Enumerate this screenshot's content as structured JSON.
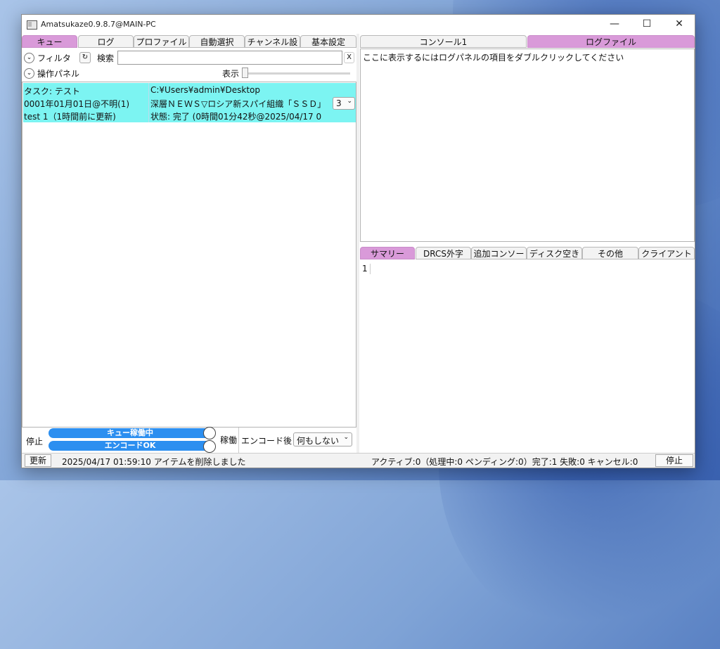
{
  "window": {
    "title": "Amatsukaze0.9.8.7@MAIN-PC",
    "min_glyph": "—",
    "max_glyph": "☐",
    "close_glyph": "✕"
  },
  "left_tabs": [
    "キュー",
    "ログ",
    "プロファイル",
    "自動選択",
    "チャンネル設",
    "基本設定"
  ],
  "filter": {
    "label": "フィルタ",
    "refresh_glyph": "↻",
    "search_label": "検索",
    "search_value": "",
    "clear_label": "X"
  },
  "operation_panel": {
    "label": "操作パネル",
    "display_label": "表示"
  },
  "queue_item": {
    "task": "タスク: テスト",
    "path": "C:¥Users¥admin¥Desktop",
    "date": "0001年01月01日@不明(1)",
    "program": "深層ＮＥＷＳ▽ロシア新スパイ組織「ＳＳＤ」",
    "priority": "3",
    "profile": "test 1（1時間前に更新)",
    "state": "状態: 完了 (0時間01分42秒@2025/04/17 0"
  },
  "bottom_controls": {
    "stop_label": "停止",
    "queue_running": "キュー稼働中",
    "encode_ok": "エンコードOK",
    "running_label": "稼働",
    "after_encode_label": "エンコード後",
    "after_encode_value": "何もしない"
  },
  "right_top_tabs": [
    "コンソール1",
    "ログファイル"
  ],
  "right_top_text": "ここに表示するにはログパネルの項目をダブルクリックしてください",
  "right_bottom_tabs": [
    "サマリー",
    "DRCS外字",
    "追加コンソー",
    "ディスク空き",
    "その他",
    "クライアント"
  ],
  "summary_text": "1",
  "status_bar": {
    "update_label": "更新",
    "message": "2025/04/17 01:59:10 アイテムを削除しました",
    "counts": "アクティブ:0（処理中:0 ペンディング:0）完了:1 失敗:0 キャンセル:0",
    "stop_label": "停止"
  },
  "colors": {
    "active_tab": "#d99ad9",
    "queue_row": "#7cf4f2",
    "pill": "#2c8ff0"
  }
}
